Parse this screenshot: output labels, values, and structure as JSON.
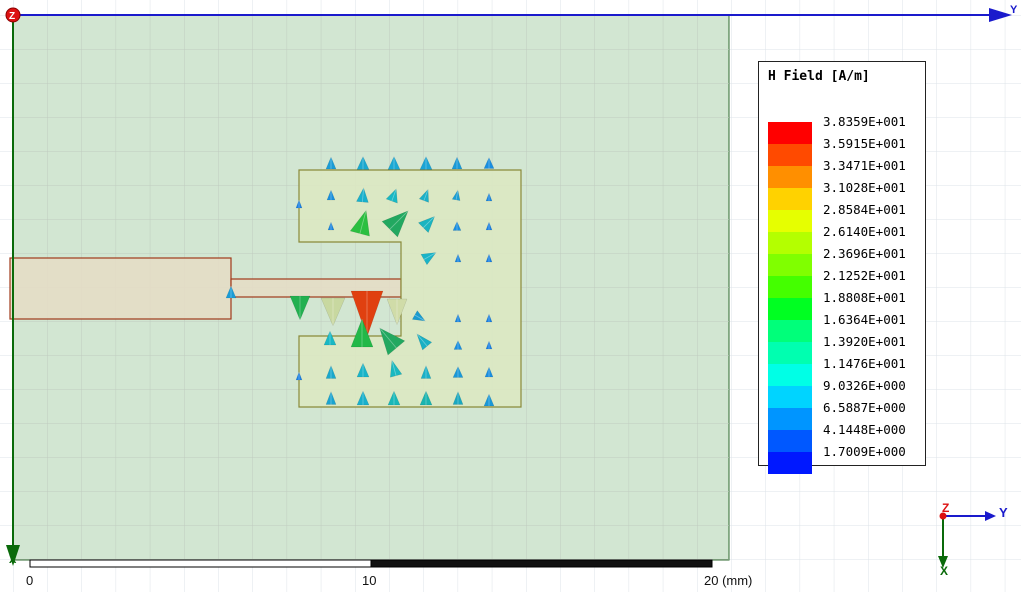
{
  "legend": {
    "title": "H Field [A/m]",
    "entries": [
      {
        "value": "3.8359E+001",
        "color": "#ff0000"
      },
      {
        "value": "3.5915E+001",
        "color": "#ff4a00"
      },
      {
        "value": "3.3471E+001",
        "color": "#ff8f00"
      },
      {
        "value": "3.1028E+001",
        "color": "#ffd200"
      },
      {
        "value": "2.8584E+001",
        "color": "#e6ff00"
      },
      {
        "value": "2.6140E+001",
        "color": "#b4ff00"
      },
      {
        "value": "2.3696E+001",
        "color": "#80ff00"
      },
      {
        "value": "2.1252E+001",
        "color": "#44ff00"
      },
      {
        "value": "1.8808E+001",
        "color": "#00ff22"
      },
      {
        "value": "1.6364E+001",
        "color": "#00ff7a"
      },
      {
        "value": "1.3920E+001",
        "color": "#00ffb0"
      },
      {
        "value": "1.1476E+001",
        "color": "#00ffe6"
      },
      {
        "value": "9.0326E+000",
        "color": "#00d4ff"
      },
      {
        "value": "6.5887E+000",
        "color": "#0095ff"
      },
      {
        "value": "4.1448E+000",
        "color": "#0058ff"
      },
      {
        "value": "1.7009E+000",
        "color": "#0018ff"
      }
    ]
  },
  "axes": {
    "main_y": "Y",
    "main_x": "X",
    "main_z": "Z",
    "triad_y": "Y",
    "triad_z": "Z",
    "triad_x": "X",
    "y_color": "#1a1acc",
    "x_color": "#0a6a0a",
    "z_color": "#dd1111"
  },
  "scale_bar": {
    "label_0": "0",
    "label_10": "10",
    "label_20": "20 (mm)"
  },
  "colors": {
    "substrate": "#d2e6d2",
    "grid": "#c8d4c8",
    "feed": "#e5dbc4",
    "feed_edge": "#a03a1a",
    "patch": "#d9e7bf",
    "patch_edge": "#8a8a3a"
  }
}
